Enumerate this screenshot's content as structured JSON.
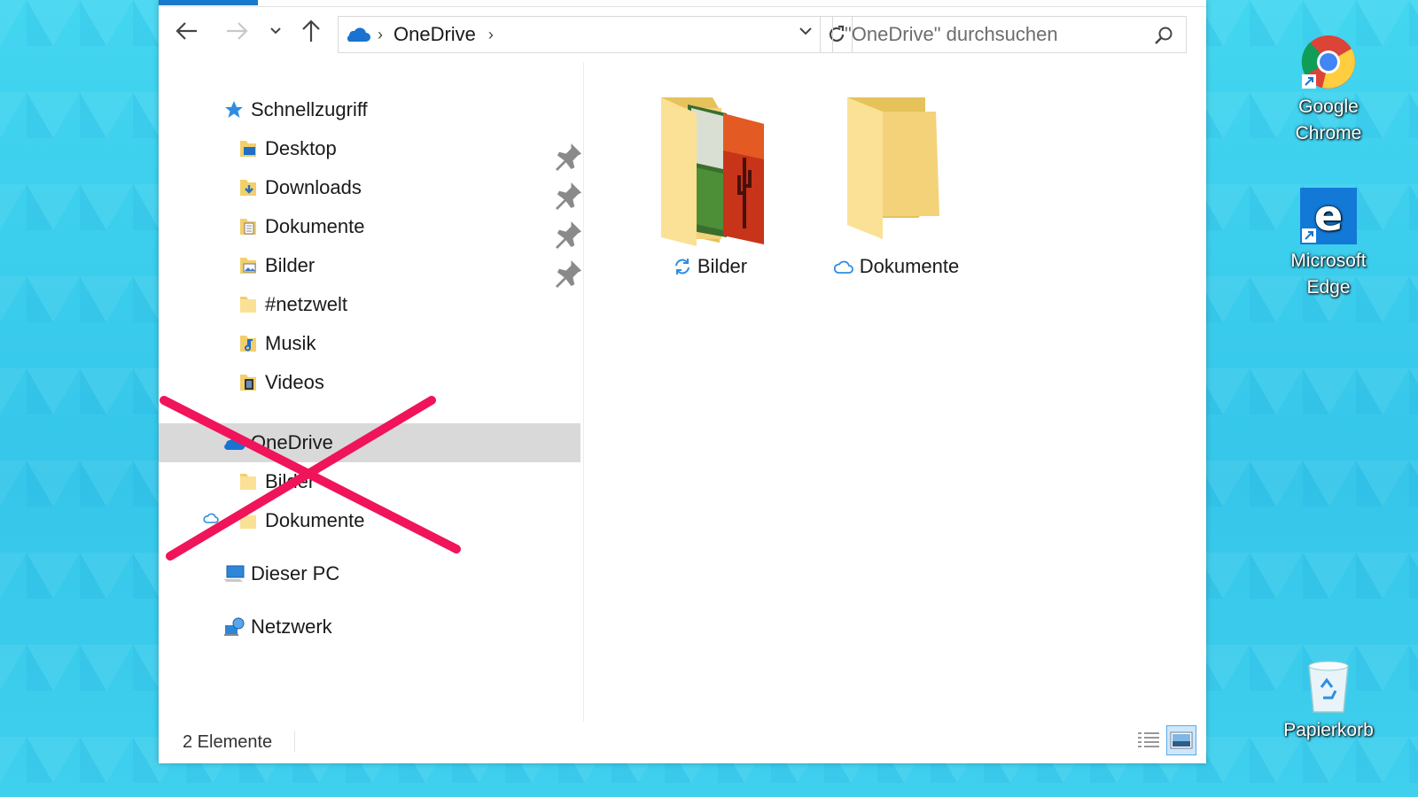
{
  "navbar": {
    "address_crumb": "OneDrive",
    "search_placeholder": "\"OneDrive\" durchsuchen"
  },
  "nav_pane": {
    "quick_access": "Schnellzugriff",
    "quick_items": [
      {
        "label": "Desktop",
        "pinned": true
      },
      {
        "label": "Downloads",
        "pinned": true
      },
      {
        "label": "Dokumente",
        "pinned": true
      },
      {
        "label": "Bilder",
        "pinned": true
      },
      {
        "label": "#netzwelt",
        "pinned": false
      },
      {
        "label": "Musik",
        "pinned": false
      },
      {
        "label": "Videos",
        "pinned": false
      }
    ],
    "onedrive": "OneDrive",
    "onedrive_items": [
      {
        "label": "Bilder"
      },
      {
        "label": "Dokumente"
      }
    ],
    "this_pc": "Dieser PC",
    "network": "Netzwerk"
  },
  "content": {
    "items": [
      {
        "label": "Bilder",
        "status_icon": "sync-icon"
      },
      {
        "label": "Dokumente",
        "status_icon": "cloud-icon"
      }
    ]
  },
  "statusbar": {
    "count": "2 Elemente"
  },
  "desktop": {
    "icons": [
      {
        "line1": "Google",
        "line2": "Chrome"
      },
      {
        "line1": "Microsoft",
        "line2": "Edge"
      },
      {
        "line1": "Papierkorb",
        "line2": ""
      }
    ]
  },
  "colors": {
    "accent": "#1979ca",
    "desktop_bg": "#3fd3ef",
    "selection": "#d9d9d9",
    "cross_out": "#f0145a"
  }
}
